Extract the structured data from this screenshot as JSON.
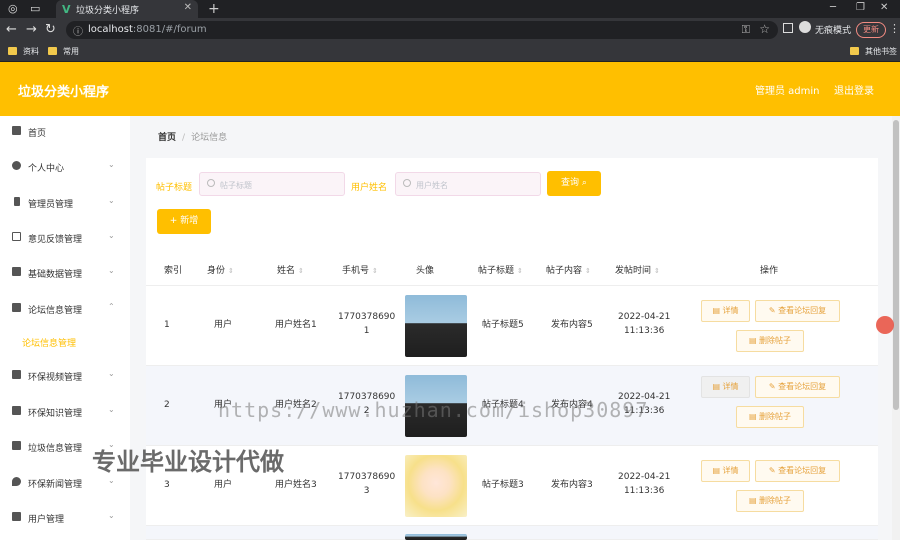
{
  "browser": {
    "tab_title": "垃圾分类小程序",
    "url_host": "localhost",
    "url_path": ":8081/#/forum",
    "incognito_label": "无痕模式",
    "update_label": "更新",
    "bookmarks": [
      "资料",
      "常用",
      "其他书签"
    ]
  },
  "header": {
    "app_title": "垃圾分类小程序",
    "admin_label": "管理员 admin",
    "logout_label": "退出登录"
  },
  "sidebar": {
    "items": [
      {
        "label": "首页",
        "icon": "home-icon"
      },
      {
        "label": "个人中心",
        "icon": "user-icon"
      },
      {
        "label": "管理员管理",
        "icon": "phone-icon"
      },
      {
        "label": "意见反馈管理",
        "icon": "copy-icon"
      },
      {
        "label": "基础数据管理",
        "icon": "grid-icon"
      },
      {
        "label": "论坛信息管理",
        "icon": "monitor-icon"
      },
      {
        "label": "环保视频管理",
        "icon": "flag-icon"
      },
      {
        "label": "环保知识管理",
        "icon": "doc-icon"
      },
      {
        "label": "垃圾信息管理",
        "icon": "chart-icon"
      },
      {
        "label": "环保新闻管理",
        "icon": "location-icon"
      },
      {
        "label": "用户管理",
        "icon": "chat-icon"
      }
    ],
    "active_sub": "论坛信息管理"
  },
  "breadcrumb": {
    "home": "首页",
    "separator": "/",
    "current": "论坛信息"
  },
  "filters": {
    "title_label": "帖子标题",
    "title_placeholder": "帖子标题",
    "name_label": "用户姓名",
    "name_placeholder": "用户姓名",
    "query_label": "查询",
    "add_label": "新增"
  },
  "table": {
    "headers": [
      "索引",
      "身份",
      "姓名",
      "手机号",
      "头像",
      "帖子标题",
      "帖子内容",
      "发帖时间",
      "操作"
    ],
    "rows": [
      {
        "index": "1",
        "role": "用户",
        "name": "用户姓名1",
        "phone1": "1770378690",
        "phone2": "1",
        "title": "帖子标题5",
        "content": "发布内容5",
        "date": "2022-04-21",
        "time": "11:13:36",
        "avatar": "boy"
      },
      {
        "index": "2",
        "role": "用户",
        "name": "用户姓名2",
        "phone1": "1770378690",
        "phone2": "2",
        "title": "帖子标题4",
        "content": "发布内容4",
        "date": "2022-04-21",
        "time": "11:13:36",
        "avatar": "boy"
      },
      {
        "index": "3",
        "role": "用户",
        "name": "用户姓名3",
        "phone1": "1770378690",
        "phone2": "3",
        "title": "帖子标题3",
        "content": "发布内容3",
        "date": "2022-04-21",
        "time": "11:13:36",
        "avatar": "girl"
      }
    ],
    "actions": {
      "detail": "详情",
      "view_replies": "查看论坛回复",
      "delete": "删除帖子"
    }
  },
  "watermarks": {
    "url": "https://www.huzhan.com/ishop30897",
    "text": "专业毕业设计代做"
  },
  "colors": {
    "accent": "#ffbf00",
    "chrome": "#202124"
  }
}
